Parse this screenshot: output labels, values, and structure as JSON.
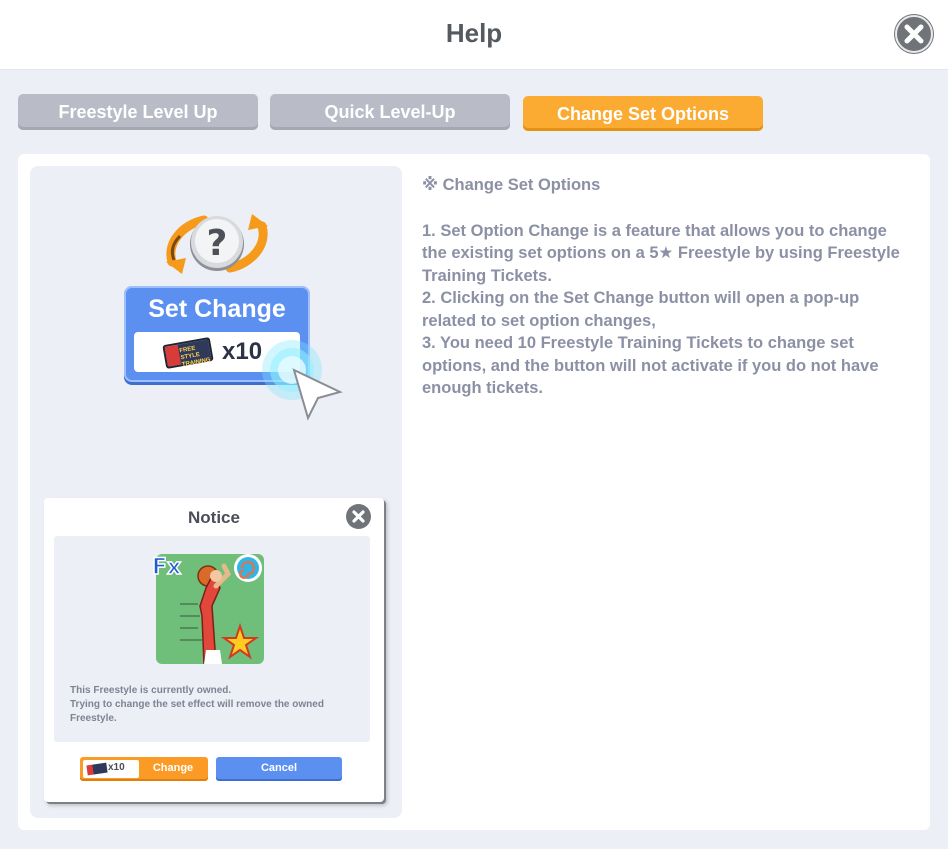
{
  "header": {
    "title": "Help"
  },
  "tabs": [
    {
      "label": "Freestyle Level Up",
      "active": false
    },
    {
      "label": "Quick Level-Up",
      "active": false
    },
    {
      "label": "Change Set Options",
      "active": true
    }
  ],
  "illustration": {
    "set_change_label": "Set Change",
    "ticket_quantity": "x10",
    "ticket_text": "FREE STYLE TRAINING"
  },
  "notice": {
    "title": "Notice",
    "message_line1": "This Freestyle is currently owned.",
    "message_line2": "Trying to change the set effect will remove the owned Freestyle.",
    "change_quantity": "x10",
    "change_label": "Change",
    "cancel_label": "Cancel"
  },
  "help": {
    "heading": "※ Change Set Options",
    "lines": [
      "1. Set Option Change is a feature that allows you to change the existing set options on a 5★ Freestyle by using Freestyle Training Tickets.",
      "2. Clicking on the Set Change button will open a pop-up related to set option changes,",
      "3. You need 10 Freestyle Training Tickets to change set options, and the button will not activate if you do not have enough tickets."
    ]
  },
  "colors": {
    "active_tab": "#fbab32",
    "inactive_tab": "#b9bcc6",
    "help_text": "#8b90a4",
    "accent_blue": "#5b8ff0"
  },
  "icons": {
    "close": "close-icon",
    "question": "question-icon",
    "cursor": "cursor-icon",
    "ticket": "ticket-icon"
  }
}
